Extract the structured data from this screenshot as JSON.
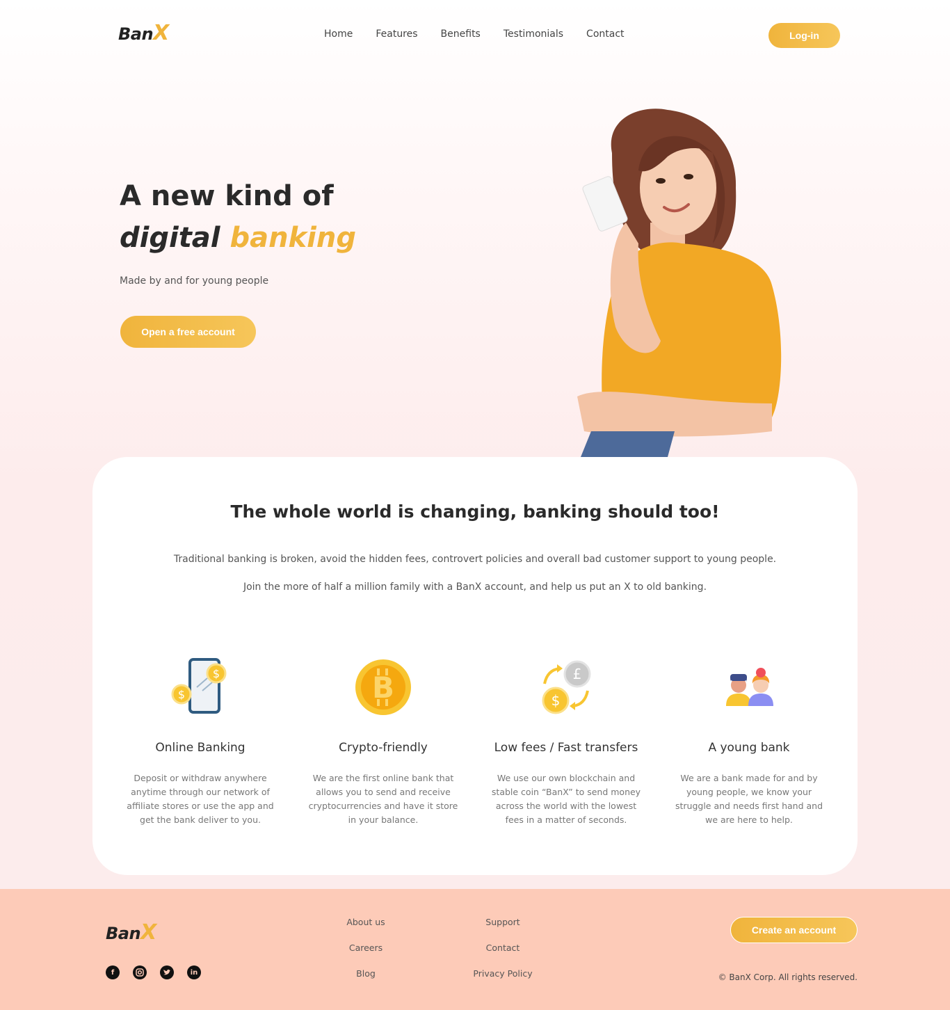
{
  "brand": {
    "name_main": "Ban",
    "name_accent": "X"
  },
  "nav": {
    "links": [
      "Home",
      "Features",
      "Benefits",
      "Testimonials",
      "Contact"
    ],
    "login_label": "Log-in"
  },
  "hero": {
    "title_line1": "A new kind of",
    "title_word_dark": "digital",
    "title_word_gold": "banking",
    "subtitle": "Made by and for young people",
    "cta_label": "Open a free account"
  },
  "intro": {
    "heading": "The whole world is changing, banking should too!",
    "paragraph1": "Traditional banking is broken, avoid the hidden fees, controvert policies and overall bad customer support to young people.",
    "paragraph2": "Join the more of half a million family with a BanX account, and help us put an X to old banking."
  },
  "features": [
    {
      "icon": "phone-money-icon",
      "title": "Online Banking",
      "text": "Deposit or withdraw anywhere anytime through our network of affiliate stores or use the app and get the bank deliver to you."
    },
    {
      "icon": "bitcoin-icon",
      "title": "Crypto-friendly",
      "text": "We are the first online bank that allows you to send and receive cryptocurrencies and have it store in your balance."
    },
    {
      "icon": "currency-exchange-icon",
      "title": "Low fees / Fast transfers",
      "text": "We use our own blockchain and stable coin “BanX” to send money across the world with the lowest fees in a matter of seconds."
    },
    {
      "icon": "young-people-icon",
      "title": "A young bank",
      "text": "We are a bank made for and by young people, we know your struggle and needs first hand and we are here to help."
    }
  ],
  "footer": {
    "col1": [
      "About us",
      "Careers",
      "Blog"
    ],
    "col2": [
      "Support",
      "Contact",
      "Privacy Policy"
    ],
    "cta_label": "Create an account",
    "copyright": "© BanX Corp. All rights reserved.",
    "socials": [
      "facebook-icon",
      "instagram-icon",
      "twitter-icon",
      "linkedin-icon"
    ]
  },
  "colors": {
    "accent": "#f0b43c",
    "footer_bg": "#fdcbb8",
    "text_dark": "#2a2a2a"
  }
}
